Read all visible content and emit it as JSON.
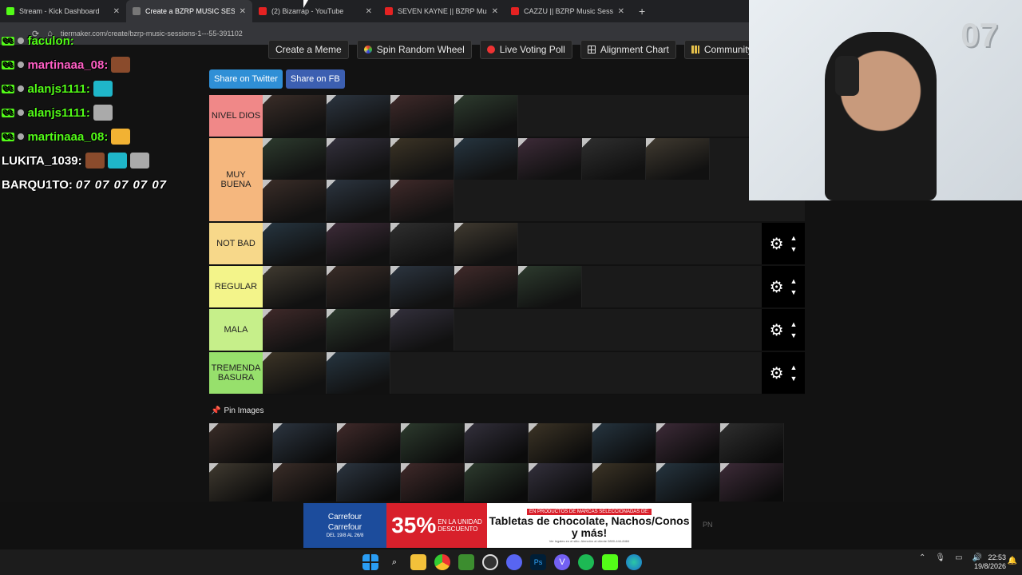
{
  "browser": {
    "tabs": [
      {
        "title": "Stream - Kick Dashboard",
        "fav": "#53fc18"
      },
      {
        "title": "Create a BZRP MUSIC SESSION",
        "fav": "#777",
        "active": true
      },
      {
        "title": "(2) Bizarrap - YouTube",
        "fav": "#e52222"
      },
      {
        "title": "SEVEN KAYNE || BZRP Music Se",
        "fav": "#e52222"
      },
      {
        "title": "CAZZU || BZRP Music Sessions",
        "fav": "#e52222"
      }
    ],
    "close_glyph": "✕",
    "newtab_glyph": "+",
    "url": "tiermaker.com/create/bzrp-music-sessions-1---55-391102"
  },
  "chat": [
    {
      "user": "faculon:",
      "color": "#53fc18",
      "emotes": 0
    },
    {
      "user": "martinaaa_08:",
      "color": "#ff5fc5",
      "emotes": 1
    },
    {
      "user": "alanjs1111:",
      "color": "#53fc18",
      "emotes": 1
    },
    {
      "user": "alanjs1111:",
      "color": "#53fc18",
      "emotes": 1
    },
    {
      "user": "martinaaa_08:",
      "color": "#53fc18",
      "emotes": 1
    },
    {
      "user": "LUKITA_1039:",
      "color": "#ffffff",
      "emotes": 3
    },
    {
      "user": "BARQU1TO:",
      "color": "#ffffff",
      "text": "07 07 07 07 07"
    }
  ],
  "toolbar": {
    "create_meme": "Create a Meme",
    "spin_wheel": "Spin Random Wheel",
    "live_poll": "Live Voting Poll",
    "alignment": "Alignment Chart",
    "community": "Community Rank"
  },
  "share": {
    "twitter": "Share on Twitter",
    "fb": "Share on FB"
  },
  "tiers": [
    {
      "label": "NIVEL DIOS",
      "color": "#f08888",
      "count": 4,
      "controls": false
    },
    {
      "label": "MUY BUENA",
      "color": "#f5b77e",
      "count": 10,
      "controls": false
    },
    {
      "label": "NOT BAD",
      "color": "#f7d88a",
      "count": 4,
      "controls": true
    },
    {
      "label": "REGULAR",
      "color": "#f3f48a",
      "count": 5,
      "controls": true
    },
    {
      "label": "MALA",
      "color": "#c6ef8a",
      "count": 3,
      "controls": true
    },
    {
      "label": "TREMENDA BASURA",
      "color": "#97e06c",
      "count": 2,
      "controls": true
    }
  ],
  "pin_images_label": "Pin Images",
  "pin_count": 18,
  "webcam": {
    "overlay_text": "07"
  },
  "ad": {
    "brand": "Carrefour",
    "brand2": "Carrefour",
    "dates": "DEL 19/8 AL 26/8",
    "percent": "35%",
    "percent_sub": "EN LA UNIDAD",
    "descuento": "DESCUENTO",
    "headline_top": "EN PRODUCTOS DE MARCAS SELECCIONADAS DE:",
    "headline": "Tabletas de chocolate, Nachos/Conos y más!",
    "fine": "Ver legales en el sitio. Atención al cliente 0800-444-8484",
    "pn": "PN"
  },
  "taskbar": {
    "time": "22:53",
    "date": "19/8/2026"
  }
}
